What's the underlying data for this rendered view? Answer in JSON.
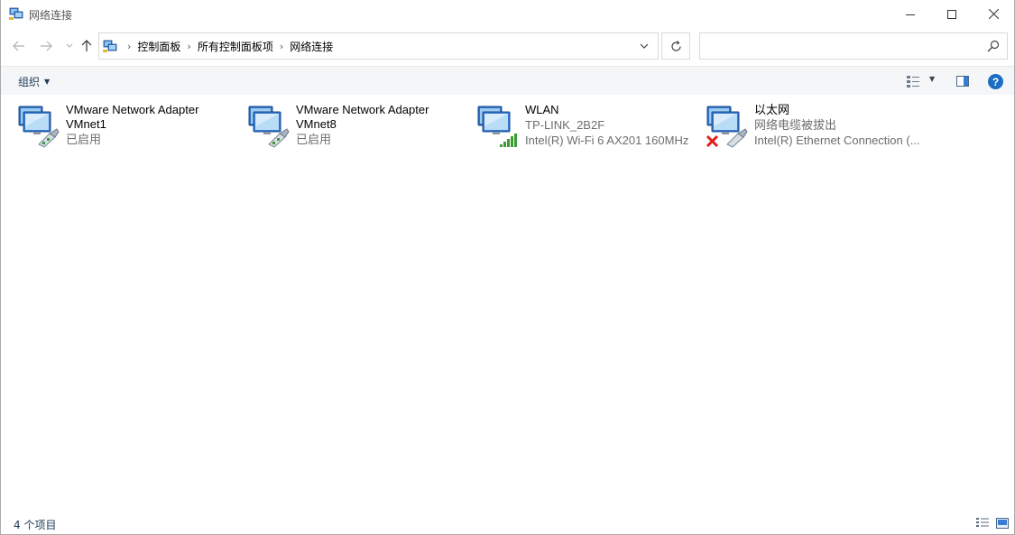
{
  "window": {
    "title": "网络连接",
    "controls": {
      "minimize": "minimize-icon",
      "maximize": "maximize-icon",
      "close": "close-icon"
    }
  },
  "nav": {
    "breadcrumbs": [
      "控制面板",
      "所有控制面板项",
      "网络连接"
    ],
    "search_placeholder": ""
  },
  "toolbar": {
    "organize_label": "组织"
  },
  "connections": [
    {
      "name": "VMware Network Adapter VMnet1",
      "line1": "VMware Network Adapter",
      "line2": "VMnet1",
      "status": "已启用",
      "kind": "wired"
    },
    {
      "name": "VMware Network Adapter VMnet8",
      "line1": "VMware Network Adapter",
      "line2": "VMnet8",
      "status": "已启用",
      "kind": "wired"
    },
    {
      "name": "WLAN",
      "line1": "WLAN",
      "line2": "TP-LINK_2B2F",
      "status": "Intel(R) Wi-Fi 6 AX201 160MHz",
      "kind": "wifi"
    },
    {
      "name": "以太网",
      "line1": "以太网",
      "line2": "网络电缆被拔出",
      "status": "Intel(R) Ethernet Connection (...",
      "kind": "disconnected"
    }
  ],
  "statusbar": {
    "item_count": "4 个项目"
  },
  "colors": {
    "accent": "#1b6ec2",
    "link_text": "#1e395b",
    "secondary_text": "#6d6d6d",
    "signal_green": "#3d9b35",
    "error_red": "#e0201b"
  }
}
